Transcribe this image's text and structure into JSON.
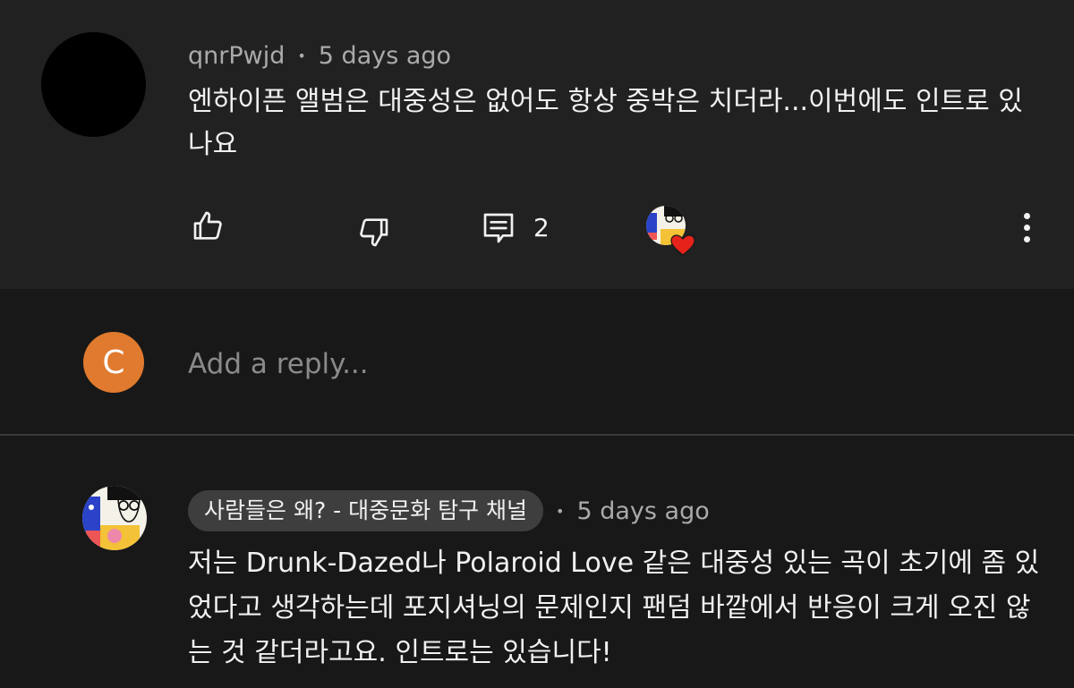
{
  "comment": {
    "author": "qnrPwjd",
    "time": "5 days ago",
    "text": "엔하이픈 앨범은 대중성은 없어도 항상 중박은 치더라...이번에도 인트로 있나요",
    "reply_count": "2",
    "icons": [
      "like-icon",
      "dislike-icon",
      "reply-icon",
      "creator-heart-icon",
      "more-vert-icon"
    ]
  },
  "reply_box": {
    "avatar_letter": "C",
    "placeholder": "Add a reply...",
    "avatar_color": "#e07a2e"
  },
  "reply": {
    "author": "사람들은 왜? - 대중문화 탐구 채널",
    "time": "5 days ago",
    "text": "저는 Drunk-Dazed나 Polaroid Love 같은 대중성 있는 곡이 초기에 좀 있었다고 생각하는데 포지셔닝의 문제인지 팬덤 바깥에서 반응이 크게 오진 않는 것 같더라고요. 인트로는 있습니다!"
  },
  "colors": {
    "comment_bg": "#212121",
    "page_bg": "#181818",
    "heart": "#e5231b"
  }
}
